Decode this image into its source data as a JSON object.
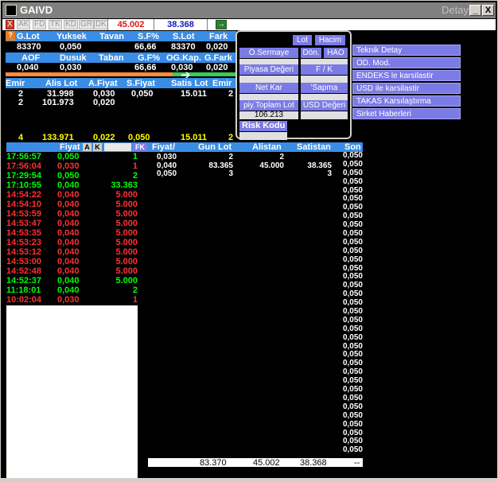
{
  "window": {
    "title": "GAIVD",
    "right_label": "Detay",
    "minimize_label": "_",
    "close_label": "X"
  },
  "toolbar": {
    "close_label": "X",
    "tabs": [
      "AK",
      "FD",
      "TK",
      "KD",
      "GR",
      "DK"
    ],
    "price_red": "45.002",
    "price_blue": "38.368",
    "arrow_label": "→"
  },
  "summary": {
    "row1_headers": [
      "G.Lot",
      "Yuksek",
      "Tavan",
      "S.F%",
      "S.Lot",
      "Fark"
    ],
    "row1_values": [
      "83370",
      "0,050",
      "",
      "66,66",
      "83370",
      "0,020"
    ],
    "row2_headers": [
      "AOF",
      "Dusuk",
      "Taban",
      "G.F%",
      "OG.Kap.",
      "G.Fark"
    ],
    "row2_values": [
      "0,040",
      "0,030",
      "",
      "66,66",
      "0,030",
      "0,020"
    ]
  },
  "orders": {
    "headers": [
      "Emir",
      "Alis Lot",
      "A.Fiyat",
      "S.Fiyat",
      "Satis Lot",
      "Emir"
    ],
    "rows": [
      [
        "2",
        "31.998",
        "0,030",
        "0,050",
        "15.011",
        "2"
      ],
      [
        "2",
        "101.973",
        "0,020",
        "",
        "",
        ""
      ]
    ],
    "totals": [
      "4",
      "133.971",
      "0,022",
      "0,050",
      "15.011",
      "2"
    ]
  },
  "popup": {
    "lot": "Lot",
    "hacim": "Hacim",
    "osermaye": "Ö.Sermaye",
    "don": "Dön.",
    "hao": "HAO",
    "piyasa_degeri": "Piyasa Değeri",
    "fk": "F / K",
    "net_kar": "Net Kar",
    "sapma": "'Sapma",
    "piy_toplam_lot": "piy.Toplam Lot",
    "usd_degeri": "USD Değeri",
    "piy_toplam_lot_value": "106.213",
    "risk_kodu": "Risk Kodu"
  },
  "menu": {
    "items": [
      "Teknik Detay",
      "OD. Mod.",
      "ENDEKS le karsilastir",
      "USD ile karsilastir",
      "TAKAS Karsılaştırma",
      "Sirket Haberleri"
    ]
  },
  "history": {
    "col_fiyat": "Fiyat",
    "btn_a": "A",
    "btn_k": "K",
    "btn_fk": "FK",
    "rows": [
      {
        "time": "17:56:57",
        "price": "0,050",
        "lot": "1",
        "c": "g"
      },
      {
        "time": "17:56:04",
        "price": "0,030",
        "lot": "1",
        "c": "r"
      },
      {
        "time": "17:29:54",
        "price": "0,050",
        "lot": "2",
        "c": "g"
      },
      {
        "time": "17:10:55",
        "price": "0,040",
        "lot": "33.363",
        "c": "g"
      },
      {
        "time": "14:54:22",
        "price": "0,040",
        "lot": "5.000",
        "c": "r"
      },
      {
        "time": "14:54:10",
        "price": "0,040",
        "lot": "5.000",
        "c": "r"
      },
      {
        "time": "14:53:59",
        "price": "0,040",
        "lot": "5.000",
        "c": "r"
      },
      {
        "time": "14:53:47",
        "price": "0,040",
        "lot": "5.000",
        "c": "r"
      },
      {
        "time": "14:53:35",
        "price": "0,040",
        "lot": "5.000",
        "c": "r"
      },
      {
        "time": "14:53:23",
        "price": "0,040",
        "lot": "5.000",
        "c": "r"
      },
      {
        "time": "14:53:12",
        "price": "0,040",
        "lot": "5.000",
        "c": "r"
      },
      {
        "time": "14:53:00",
        "price": "0,040",
        "lot": "5.000",
        "c": "r"
      },
      {
        "time": "14:52:48",
        "price": "0,040",
        "lot": "5.000",
        "c": "r"
      },
      {
        "time": "14:52:37",
        "price": "0,040",
        "lot": "5.000",
        "c": "g"
      },
      {
        "time": "11:18:01",
        "price": "0,040",
        "lot": "2",
        "c": "g"
      },
      {
        "time": "10:02:04",
        "price": "0,030",
        "lot": "1",
        "c": "r"
      }
    ]
  },
  "depth": {
    "headers": [
      "Fiyat",
      "Gun Lot",
      "Alistan",
      "Satistan",
      "Son"
    ],
    "sort_marker": "/",
    "rows": [
      [
        "0,030",
        "2",
        "2",
        ""
      ],
      [
        "0,040",
        "83.365",
        "45.000",
        "38.365"
      ],
      [
        "0,050",
        "3",
        "",
        "3"
      ]
    ],
    "son_value": "0,050",
    "son_count": 35,
    "totals": [
      "83.370",
      "45.002",
      "38.368",
      "--"
    ]
  }
}
